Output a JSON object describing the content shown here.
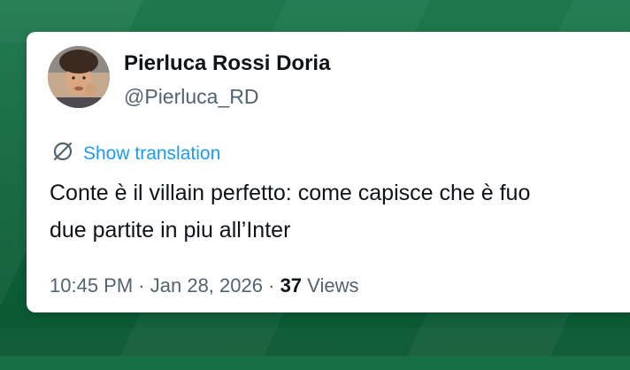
{
  "tweet": {
    "author_name": "Pierluca Rossi Doria",
    "handle": "@Pierluca_RD",
    "translation_label": "Show translation",
    "text_line1": "Conte è il villain perfetto: come capisce che è fuo",
    "text_line2": "due partite in piu all’Inter",
    "time": "10:45 PM",
    "date": "Jan 28, 2026",
    "separator": "·",
    "views_count": "37",
    "views_label": "Views"
  },
  "colors": {
    "background": "#0f6b3e",
    "card": "#ffffff",
    "link": "#1d9bf0",
    "text_primary": "#0f1419",
    "text_secondary": "#536471"
  },
  "icons": {
    "translate": "translate-icon",
    "avatar": "avatar"
  }
}
